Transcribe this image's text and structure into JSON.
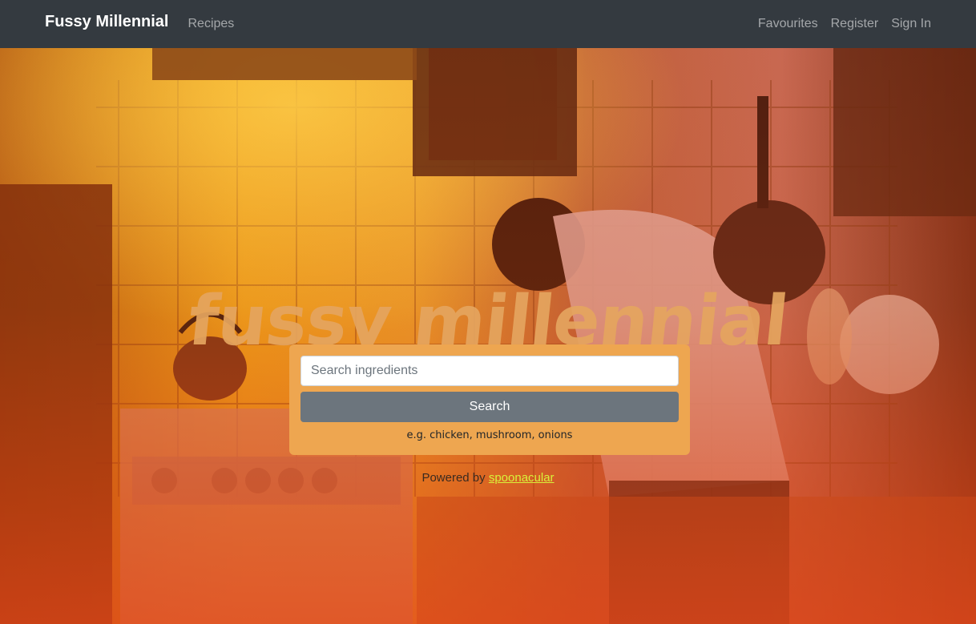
{
  "navbar": {
    "brand": "Fussy Millennial",
    "left_links": [
      {
        "label": "Recipes"
      }
    ],
    "right_links": [
      {
        "label": "Favourites"
      },
      {
        "label": "Register"
      },
      {
        "label": "Sign In"
      }
    ]
  },
  "hero": {
    "title": "fussy millennial",
    "search": {
      "placeholder": "Search ingredients",
      "value": "",
      "button_label": "Search",
      "hint": "e.g. chicken, mushroom, onions"
    },
    "powered_by": {
      "prefix": "Powered by",
      "link_label": "spoonacular"
    }
  },
  "colors": {
    "navbar_bg": "#343a40",
    "card_bg": "#eea650",
    "button_bg": "#6c757d",
    "link_accent": "#d9f13a",
    "title_color": "#e5a55f"
  },
  "icons": [
    "kitchen-background-photo"
  ]
}
